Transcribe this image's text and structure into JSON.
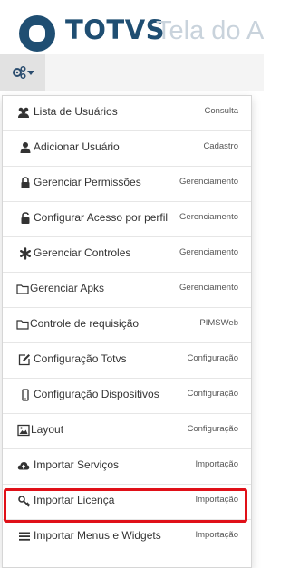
{
  "header": {
    "brand": "TOTVS",
    "app_title": "Tela do Ad",
    "logo_icon": "totvs-logo-icon",
    "colors": {
      "brand": "#1f4e72",
      "title": "#c9d3dc"
    }
  },
  "toolbar": {
    "settings_icon": "gear-icon",
    "dropdown_icon": "caret-down-icon"
  },
  "menu": {
    "items": [
      {
        "label": "Lista de Usuários",
        "category": "Consulta",
        "icon": "users-icon"
      },
      {
        "label": "Adicionar Usuário",
        "category": "Cadastro",
        "icon": "user-icon"
      },
      {
        "label": "Gerenciar Permissões",
        "category": "Gerenciamento",
        "icon": "lock-icon"
      },
      {
        "label": "Configurar Acesso por perfil",
        "category": "Gerenciamento",
        "icon": "unlock-icon"
      },
      {
        "label": "Gerenciar Controles",
        "category": "Gerenciamento",
        "icon": "asterisk-icon"
      },
      {
        "label": "Gerenciar Apks",
        "category": "Gerenciamento",
        "icon": "folder-icon"
      },
      {
        "label": "Controle de requisição",
        "category": "PIMSWeb",
        "icon": "folder-icon"
      },
      {
        "label": "Configuração Totvs",
        "category": "Configuração",
        "icon": "edit-icon"
      },
      {
        "label": "Configuração Dispositivos",
        "category": "Configuração",
        "icon": "mobile-icon"
      },
      {
        "label": "Layout",
        "category": "Configuração",
        "icon": "picture-icon"
      },
      {
        "label": "Importar Serviços",
        "category": "Importação",
        "icon": "cloud-upload-icon"
      },
      {
        "label": "Importar Licença",
        "category": "Importação",
        "icon": "key-icon",
        "highlighted": true
      },
      {
        "label": "Importar Menus e Widgets",
        "category": "Importação",
        "icon": "list-icon"
      }
    ],
    "highlight_color": "#e01018"
  }
}
